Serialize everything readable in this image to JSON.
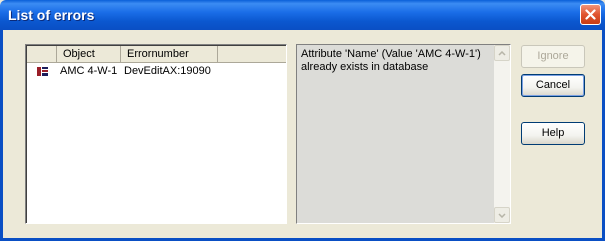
{
  "window": {
    "title": "List of errors"
  },
  "list": {
    "columns": [
      "",
      "Object",
      "Errornumber",
      ""
    ],
    "rows": [
      {
        "icon": "flag-icon",
        "object": "AMC 4-W-1",
        "errornumber": "DevEditAX:19090"
      }
    ]
  },
  "detail": {
    "message": "Attribute 'Name' (Value 'AMC 4-W-1')\nalready exists in database"
  },
  "buttons": {
    "ignore": "Ignore",
    "cancel": "Cancel",
    "help": "Help"
  },
  "colors": {
    "title_bar": "#0a5fd8",
    "close_button": "#e0542f",
    "window_face": "#ece9d8"
  }
}
